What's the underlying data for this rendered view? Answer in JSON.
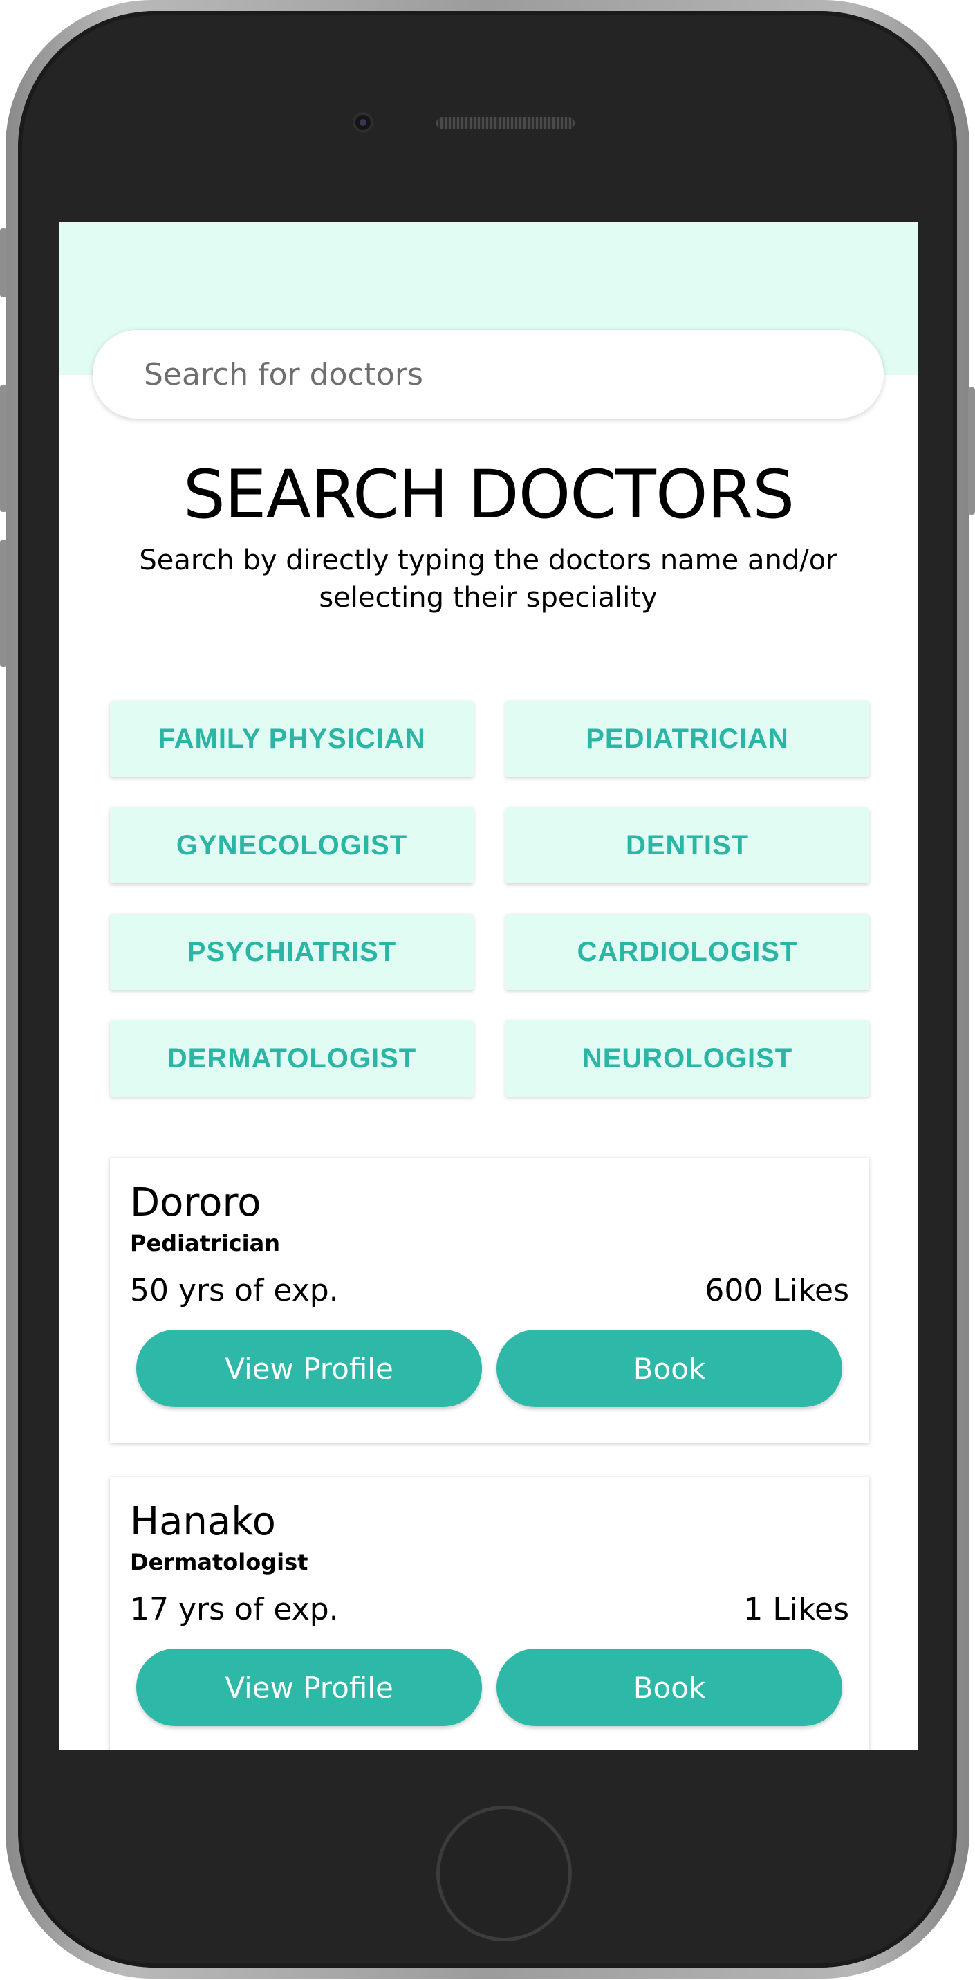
{
  "search": {
    "placeholder": "Search for doctors"
  },
  "page": {
    "title": "SEARCH DOCTORS",
    "subtitle": "Search by directly typing the doctors name and/or selecting their speciality"
  },
  "specialities": [
    "FAMILY PHYSICIAN",
    "PEDIATRICIAN",
    "GYNECOLOGIST",
    "DENTIST",
    "PSYCHIATRIST",
    "CARDIOLOGIST",
    "DERMATOLOGIST",
    "NEUROLOGIST"
  ],
  "doctors": [
    {
      "name": "Dororo",
      "speciality": "Pediatrician",
      "experience": "50 yrs of exp.",
      "likes": "600 Likes",
      "view_label": "View Profile",
      "book_label": "Book"
    },
    {
      "name": "Hanako",
      "speciality": "Dermatologist",
      "experience": "17 yrs of exp.",
      "likes": "1 Likes",
      "view_label": "View Profile",
      "book_label": "Book"
    }
  ],
  "colors": {
    "accent": "#2db8a8",
    "accent_text": "#2bb5a4",
    "mint_background": "#e0fcf3",
    "phone_body": "#242424"
  },
  "icons": [
    "camera-icon",
    "speaker-grille",
    "home-button"
  ]
}
